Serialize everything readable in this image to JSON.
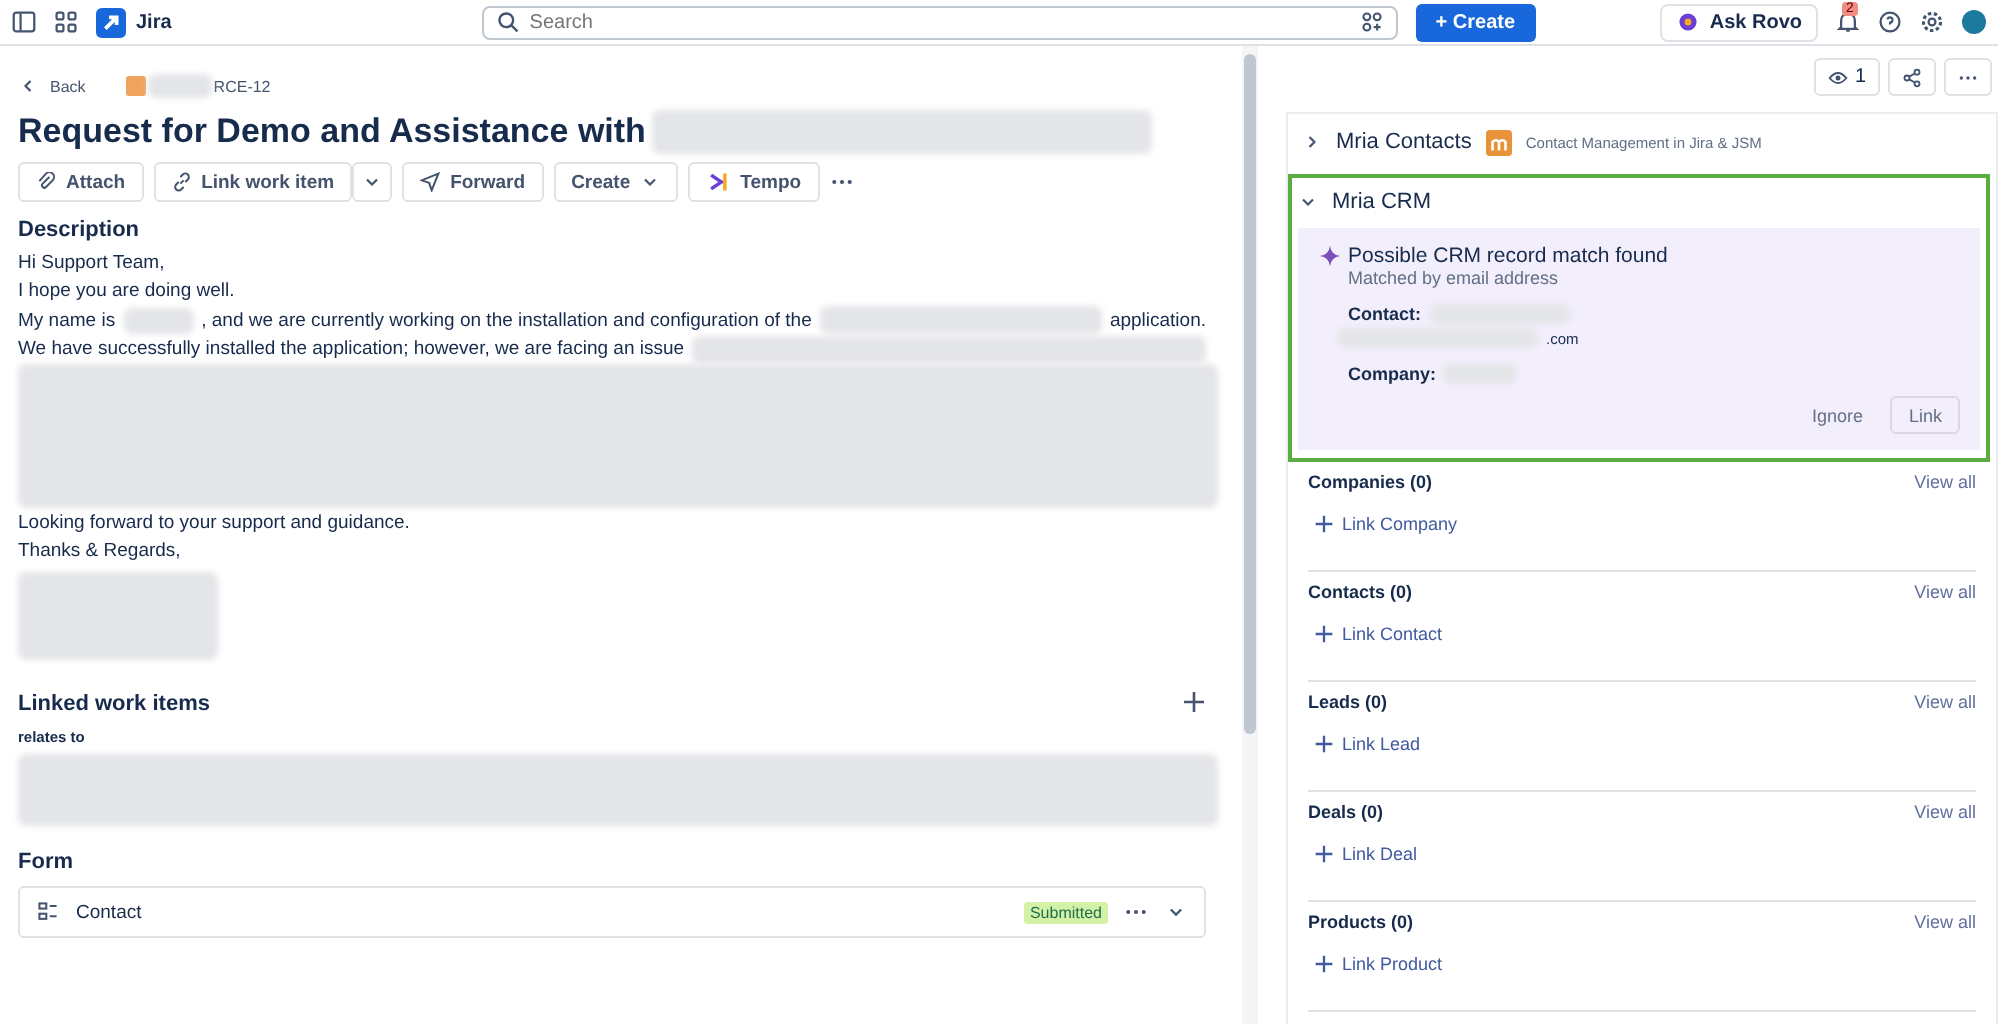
{
  "topbar": {
    "product": "Jira",
    "search": {
      "placeholder": "Search"
    },
    "create": "+ Create",
    "ask": "Ask Rovo",
    "notifications": "2"
  },
  "breadcrumb": {
    "back": "Back",
    "key": "RCE-12"
  },
  "title": "Request for Demo and Assistance with",
  "toolbar": [
    {
      "kind": "attach",
      "label": "Attach"
    },
    {
      "kind": "link",
      "label": "Link work item"
    },
    {
      "kind": "forward",
      "label": "Forward"
    },
    {
      "kind": "create",
      "label": "Create"
    },
    {
      "kind": "tempo",
      "label": "Tempo"
    }
  ],
  "description": {
    "heading": "Description",
    "lines": [
      {
        "text": "Hi Support Team,",
        "kind": "plain"
      },
      {
        "text": "I hope you are doing well.",
        "kind": "plain"
      },
      {
        "text": "My name is",
        "after": ", and we are currently working on the installation and configuration of the",
        "end": "application.",
        "kind": "inline"
      },
      {
        "text": "We have successfully installed the application; however, we are facing an issue",
        "kind": "tail"
      },
      {
        "text": "Looking forward to your support and guidance.",
        "kind": "plain"
      },
      {
        "text": "Thanks & Regards,",
        "kind": "plain"
      }
    ]
  },
  "linked": {
    "heading": "Linked work items",
    "relation": "relates to"
  },
  "form": {
    "heading": "Form",
    "name": "Contact",
    "status": "Submitted"
  },
  "side": {
    "watchers": "1",
    "apps": [
      {
        "title": "Mria Contacts",
        "subtitle": "Contact Management in Jira & JSM",
        "expanded": false
      },
      {
        "title": "Mria CRM",
        "expanded": true
      }
    ],
    "match": {
      "title": "Possible CRM record match found",
      "subtitle": "Matched by email address",
      "contact_label": "Contact:",
      "email_tail": ".com",
      "company_label": "Company:",
      "ignore": "Ignore",
      "link": "Link"
    },
    "sections": [
      {
        "title": "Companies (0)",
        "view": "View all",
        "action": "Link Company"
      },
      {
        "title": "Contacts (0)",
        "view": "View all",
        "action": "Link Contact"
      },
      {
        "title": "Leads (0)",
        "view": "View all",
        "action": "Link Lead"
      },
      {
        "title": "Deals (0)",
        "view": "View all",
        "action": "Link Deal"
      },
      {
        "title": "Products (0)",
        "view": "View all",
        "action": "Link Product"
      }
    ]
  }
}
